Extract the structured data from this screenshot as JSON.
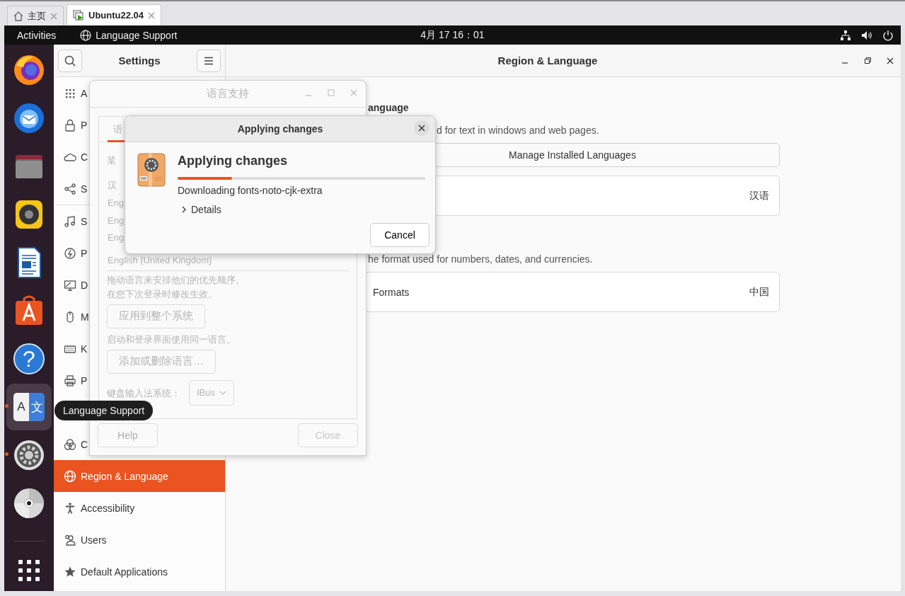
{
  "vm_tabs": [
    {
      "label": "主页",
      "selected": false
    },
    {
      "label": "Ubuntu22.04",
      "selected": true
    }
  ],
  "top_bar": {
    "activities": "Activities",
    "app_menu": "Language Support",
    "clock": "4月 17 16：01"
  },
  "dock": {
    "items": [
      {
        "running": false,
        "selected": false
      },
      {
        "running": false,
        "selected": false
      },
      {
        "running": false,
        "selected": false
      },
      {
        "running": false,
        "selected": false
      },
      {
        "running": false,
        "selected": false
      },
      {
        "running": false,
        "selected": false
      },
      {
        "running": false,
        "selected": false,
        "glyphs": [
          "?"
        ]
      },
      {
        "running": true,
        "selected": true,
        "glyphs": [
          "A",
          "文"
        ]
      },
      {
        "running": true,
        "selected": false
      },
      {
        "running": false,
        "selected": false
      }
    ]
  },
  "tooltip": "Language Support",
  "settings": {
    "title": "Settings",
    "sidebar": {
      "items": [
        {
          "label": "A",
          "selected": false
        },
        {
          "label": "P",
          "selected": false
        },
        {
          "label": "C",
          "selected": false
        },
        {
          "label": "S",
          "selected": false
        },
        {
          "label": "S",
          "selected": false
        },
        {
          "label": "P",
          "selected": false
        },
        {
          "label": "D",
          "selected": false
        },
        {
          "label": "M",
          "selected": false
        },
        {
          "label": "K",
          "selected": false
        },
        {
          "label": "P",
          "selected": false
        }
      ],
      "lower_items": [
        {
          "label": "C",
          "selected": false
        },
        {
          "label": "Region & Language",
          "selected": true
        },
        {
          "label": "Accessibility",
          "selected": false
        },
        {
          "label": "Users",
          "selected": false
        },
        {
          "label": "Default Applications",
          "selected": false
        }
      ]
    },
    "panel": {
      "title": "Region & Language",
      "sections": [
        {
          "heading": "anguage",
          "description": "d for text in windows and web pages.",
          "button": "Manage Installed Languages",
          "row": {
            "value": "汉语"
          }
        },
        {
          "description": "he format used for numbers, dates, and currencies.",
          "row": {
            "label": "Formats",
            "value": "中国"
          }
        }
      ]
    }
  },
  "language_window": {
    "title": "语言支持",
    "insensitive": true,
    "tab": "语",
    "section_label": "菜",
    "languages": [
      "汉",
      "Eng",
      "Eng",
      "Eng",
      "English (United Kingdom)"
    ],
    "hint_lines": [
      "拖动语言来安排他们的优先顺序。",
      "在您下次登录时修改生效。"
    ],
    "apply_button": "应用到整个系统",
    "login_note": "启动和登录界面使用同一语言。",
    "add_button": "添加或删除语言…",
    "input_label": "键盘输入法系统：",
    "input_method": "IBus",
    "help_button": "Help",
    "close_button": {
      "label": "Close",
      "disabled": true
    }
  },
  "applying_dialog": {
    "title": "Applying changes",
    "heading": "Applying changes",
    "level": 0.22,
    "status": "Downloading fonts-noto-cjk-extra",
    "details": {
      "label": "Details",
      "expanded": false
    },
    "cancel_button": "Cancel"
  }
}
